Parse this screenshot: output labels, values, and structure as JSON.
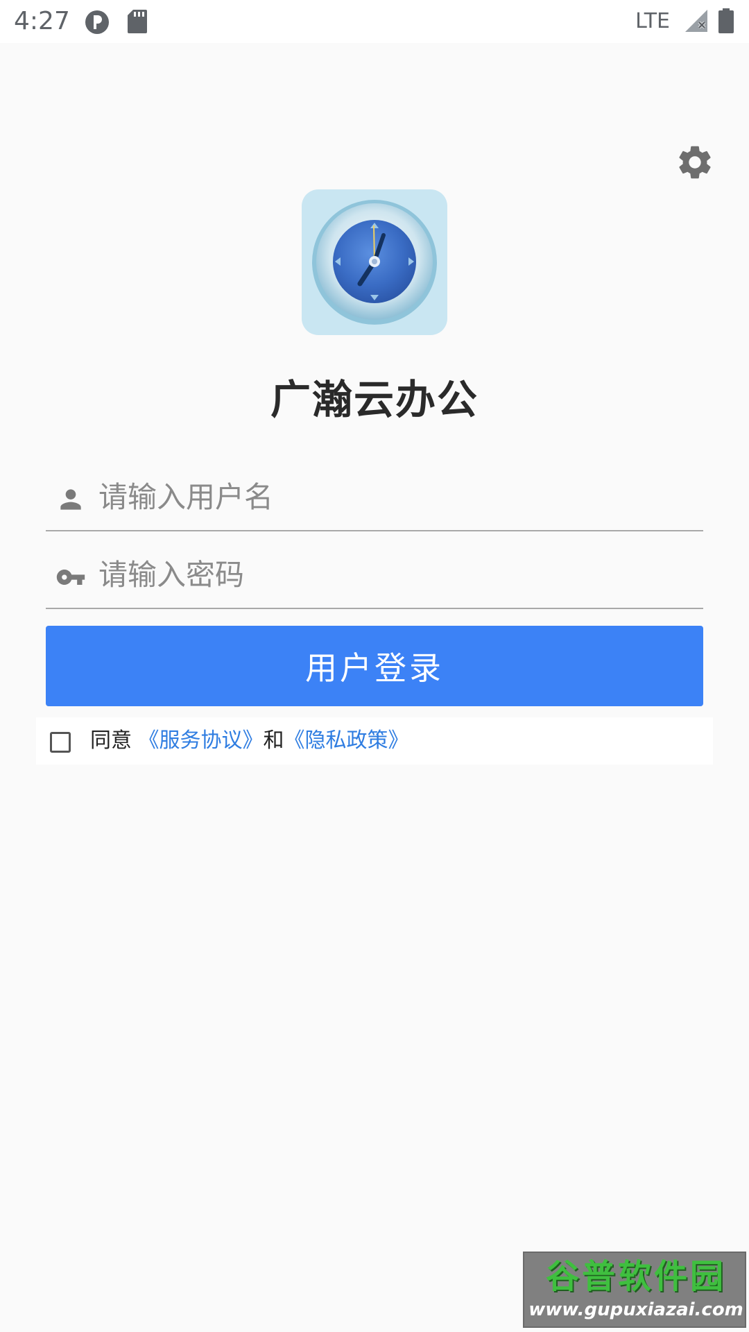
{
  "status_bar": {
    "time": "4:27",
    "network": "LTE",
    "icons": [
      "app-notification-icon",
      "sd-card-icon",
      "signal-icon",
      "battery-icon"
    ]
  },
  "settings": {
    "icon": "gear-icon"
  },
  "app": {
    "logo_icon": "clock-icon",
    "title": "广瀚云办公"
  },
  "login_form": {
    "username": {
      "icon": "person-icon",
      "placeholder": "请输入用户名",
      "value": ""
    },
    "password": {
      "icon": "key-icon",
      "placeholder": "请输入密码",
      "value": ""
    },
    "login_button": "用户登录"
  },
  "agreement": {
    "checked": false,
    "prefix": "同意",
    "terms_link": "《服务协议》",
    "conjunction": "和",
    "privacy_link": "《隐私政策》"
  },
  "watermark": {
    "title": "谷普软件园",
    "url": "www.gupuxiazai.com"
  },
  "colors": {
    "primary": "#3c82f6",
    "link": "#2f7de1",
    "background": "#fafafa"
  }
}
